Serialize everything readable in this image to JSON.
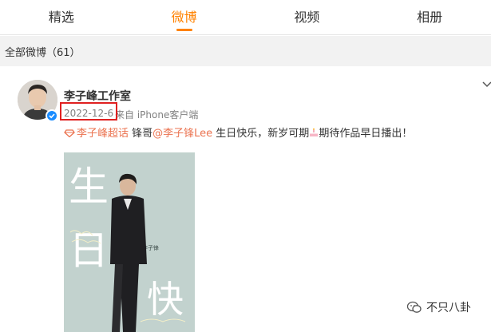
{
  "tabs": [
    {
      "label": "精选"
    },
    {
      "label": "微博"
    },
    {
      "label": "视频"
    },
    {
      "label": "相册"
    }
  ],
  "active_tab": "微博",
  "accent_color": "#ff8200",
  "filter": {
    "label": "全部微博（61）"
  },
  "post": {
    "username": "李子峰工作室",
    "date": "2022-12-6",
    "source": "来自 iPhone客户端",
    "text": {
      "supertopic": "李子峰超话",
      "word1": " 锋哥",
      "mention": "@李子锋Lee",
      "body_before_icon": " 生日快乐，新岁可期",
      "body_after_icon": "期待作品早日播出！"
    },
    "highlight_color": "#eb7350",
    "verified_badge_color": "#1a8cff",
    "highlight_box_color": "#e02020",
    "poster": {
      "big_chars": [
        "生",
        "日",
        "快"
      ],
      "name_small": "李子锋"
    }
  },
  "watermark": {
    "text": "不只八卦"
  }
}
